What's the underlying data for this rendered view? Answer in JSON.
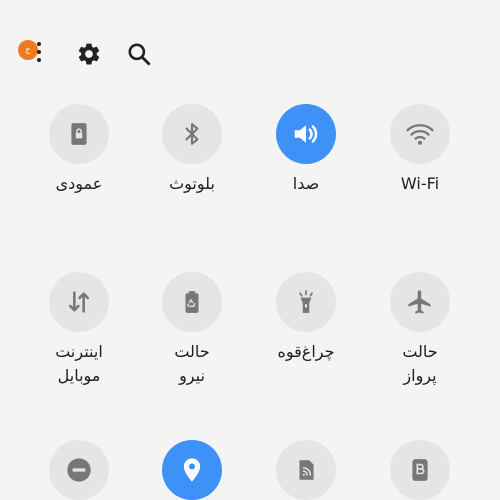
{
  "header": {
    "badge_text": "ج",
    "icons": [
      "more-vert-icon",
      "gear-icon",
      "search-icon"
    ]
  },
  "colors": {
    "background": "#f4f4f4",
    "tile_inactive": "#e5e5e5",
    "tile_active": "#3e91f6",
    "icon_inactive": "#777777",
    "badge": "#f07a1f"
  },
  "tiles": {
    "rotate": {
      "label": "عمودی",
      "icon": "portrait-lock-icon",
      "active": false
    },
    "bluetooth": {
      "label": "بلوتوث",
      "icon": "bluetooth-icon",
      "active": false
    },
    "sound": {
      "label": "صدا",
      "icon": "volume-icon",
      "active": true
    },
    "wifi": {
      "label": "Wi-Fi",
      "icon": "wifi-icon",
      "active": false
    },
    "mobile_data": {
      "label_line1": "اینترنت",
      "label_line2": "موبایل",
      "icon": "data-transfer-icon",
      "active": false
    },
    "power_mode": {
      "label_line1": "حالت",
      "label_line2": "نیرو",
      "icon": "battery-recycle-icon",
      "active": false
    },
    "flashlight": {
      "label": "چراغ‌قوه",
      "icon": "flashlight-icon",
      "active": false
    },
    "airplane": {
      "label_line1": "حالت",
      "label_line2": "پرواز",
      "icon": "airplane-icon",
      "active": false
    },
    "dnd": {
      "icon": "do-not-disturb-icon",
      "active": false
    },
    "location": {
      "icon": "location-icon",
      "active": true
    },
    "nfc": {
      "icon": "nfc-icon",
      "active": false
    },
    "bixby": {
      "icon": "bixby-icon",
      "active": false
    }
  }
}
